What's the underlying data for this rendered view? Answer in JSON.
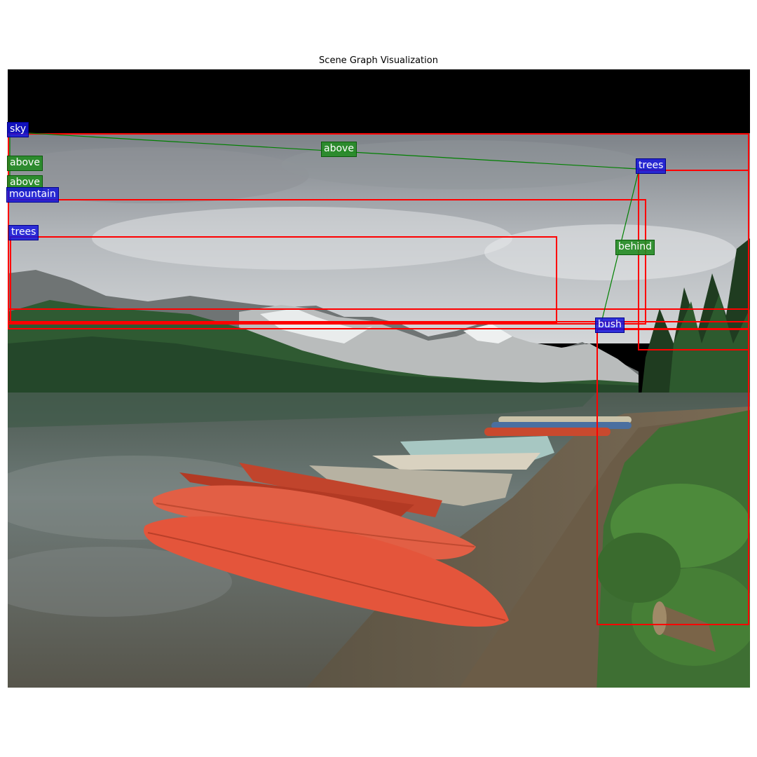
{
  "title": "Scene Graph Visualization",
  "colors": {
    "box": "#ff0000",
    "edge": "#008000",
    "object_label_bg": "#1414dc",
    "relation_label_bg": "#228b22",
    "label_text": "#ffffff"
  },
  "objects": [
    {
      "id": "sky",
      "label": "sky"
    },
    {
      "id": "trees_right",
      "label": "trees"
    },
    {
      "id": "mountain",
      "label": "mountain"
    },
    {
      "id": "trees_left",
      "label": "trees"
    },
    {
      "id": "bush",
      "label": "bush"
    }
  ],
  "relations": [
    {
      "id": "rel1",
      "subject": "sky",
      "predicate": "above",
      "object": "trees_right"
    },
    {
      "id": "rel2",
      "subject": "sky",
      "predicate": "above",
      "object": "mountain"
    },
    {
      "id": "rel3",
      "subject": "sky",
      "predicate": "above",
      "object": "trees_left"
    },
    {
      "id": "rel4",
      "subject": "trees_right",
      "predicate": "behind",
      "object": "bush"
    }
  ]
}
